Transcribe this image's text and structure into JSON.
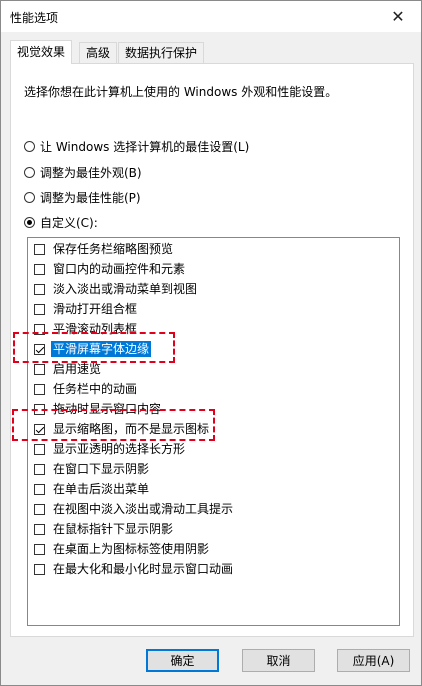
{
  "window": {
    "title": "性能选项",
    "close_glyph": "✕"
  },
  "tabs": [
    {
      "label": "视觉效果",
      "active": true
    },
    {
      "label": "高级",
      "active": false
    },
    {
      "label": "数据执行保护",
      "active": false
    }
  ],
  "description": "选择你想在此计算机上使用的 Windows 外观和性能设置。",
  "radios": [
    {
      "label": "让 Windows 选择计算机的最佳设置(L)",
      "checked": false
    },
    {
      "label": "调整为最佳外观(B)",
      "checked": false
    },
    {
      "label": "调整为最佳性能(P)",
      "checked": false
    },
    {
      "label": "自定义(C):",
      "checked": true
    }
  ],
  "options": [
    {
      "label": "保存任务栏缩略图预览",
      "checked": false
    },
    {
      "label": "窗口内的动画控件和元素",
      "checked": false
    },
    {
      "label": "淡入淡出或滑动菜单到视图",
      "checked": false
    },
    {
      "label": "滑动打开组合框",
      "checked": false
    },
    {
      "label": "平滑滚动列表框",
      "checked": false
    },
    {
      "label": "平滑屏幕字体边缘",
      "checked": true,
      "selected": true
    },
    {
      "label": "启用速览",
      "checked": false
    },
    {
      "label": "任务栏中的动画",
      "checked": false
    },
    {
      "label": "拖动时显示窗口内容",
      "checked": false
    },
    {
      "label": "显示缩略图，而不是显示图标",
      "checked": true
    },
    {
      "label": "显示亚透明的选择长方形",
      "checked": false
    },
    {
      "label": "在窗口下显示阴影",
      "checked": false
    },
    {
      "label": "在单击后淡出菜单",
      "checked": false
    },
    {
      "label": "在视图中淡入淡出或滑动工具提示",
      "checked": false
    },
    {
      "label": "在鼠标指针下显示阴影",
      "checked": false
    },
    {
      "label": "在桌面上为图标标签使用阴影",
      "checked": false
    },
    {
      "label": "在最大化和最小化时显示窗口动画",
      "checked": false
    }
  ],
  "buttons": {
    "ok": "确定",
    "cancel": "取消",
    "apply": "应用(A)"
  },
  "colors": {
    "selection": "#0078d7",
    "annotation": "#e0001b"
  }
}
